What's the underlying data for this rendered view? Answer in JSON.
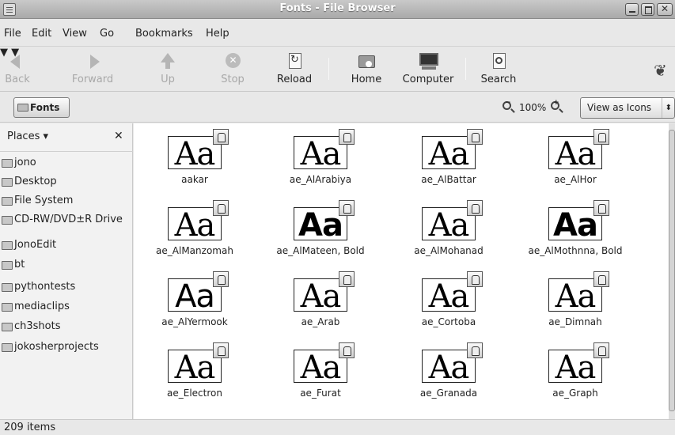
{
  "window": {
    "title": "Fonts - File Browser"
  },
  "menubar": {
    "items": [
      "File",
      "Edit",
      "View",
      "Go",
      "Bookmarks",
      "Help"
    ]
  },
  "toolbar": {
    "back": "Back",
    "forward": "Forward",
    "up": "Up",
    "stop": "Stop",
    "reload": "Reload",
    "home": "Home",
    "computer": "Computer",
    "search": "Search"
  },
  "location": {
    "current": "Fonts",
    "zoom": "100%",
    "view_mode": "View as Icons"
  },
  "sidebar": {
    "header": "Places",
    "items": [
      {
        "label": "jono",
        "icon": "home-icon"
      },
      {
        "label": "Desktop",
        "icon": "desktop-icon"
      },
      {
        "label": "File System",
        "icon": "drive-icon"
      },
      {
        "label": "CD-RW/DVD±R Drive",
        "icon": "optical-drive-icon"
      },
      {
        "label": "JonoEdit",
        "icon": "folder-icon"
      },
      {
        "label": "bt",
        "icon": "folder-icon"
      },
      {
        "label": "pythontests",
        "icon": "folder-icon"
      },
      {
        "label": "mediaclips",
        "icon": "folder-icon"
      },
      {
        "label": "ch3shots",
        "icon": "folder-icon"
      },
      {
        "label": "jokosherprojects",
        "icon": "folder-icon"
      }
    ]
  },
  "fonts": [
    {
      "name": "aakar",
      "preview": "Aa",
      "style": "serif"
    },
    {
      "name": "ae_AlArabiya",
      "preview": "Aa",
      "style": "serif"
    },
    {
      "name": "ae_AlBattar",
      "preview": "Aa",
      "style": "serif"
    },
    {
      "name": "ae_AlHor",
      "preview": "Aa",
      "style": "serif"
    },
    {
      "name": "ae_AlManzomah",
      "preview": "Aa",
      "style": "serif"
    },
    {
      "name": "ae_AlMateen, Bold",
      "preview": "Aa",
      "style": "sans-bold"
    },
    {
      "name": "ae_AlMohanad",
      "preview": "Aa",
      "style": "serif"
    },
    {
      "name": "ae_AlMothnna, Bold",
      "preview": "Aa",
      "style": "sans-bold"
    },
    {
      "name": "ae_AlYermook",
      "preview": "Aa",
      "style": "sans"
    },
    {
      "name": "ae_Arab",
      "preview": "Aa",
      "style": "serif"
    },
    {
      "name": "ae_Cortoba",
      "preview": "Aa",
      "style": "serif"
    },
    {
      "name": "ae_Dimnah",
      "preview": "Aa",
      "style": "serif"
    },
    {
      "name": "ae_Electron",
      "preview": "Aa",
      "style": "serif"
    },
    {
      "name": "ae_Furat",
      "preview": "Aa",
      "style": "serif"
    },
    {
      "name": "ae_Granada",
      "preview": "Aa",
      "style": "serif"
    },
    {
      "name": "ae_Graph",
      "preview": "Aa",
      "style": "serif"
    }
  ],
  "status": {
    "text": "209 items"
  }
}
